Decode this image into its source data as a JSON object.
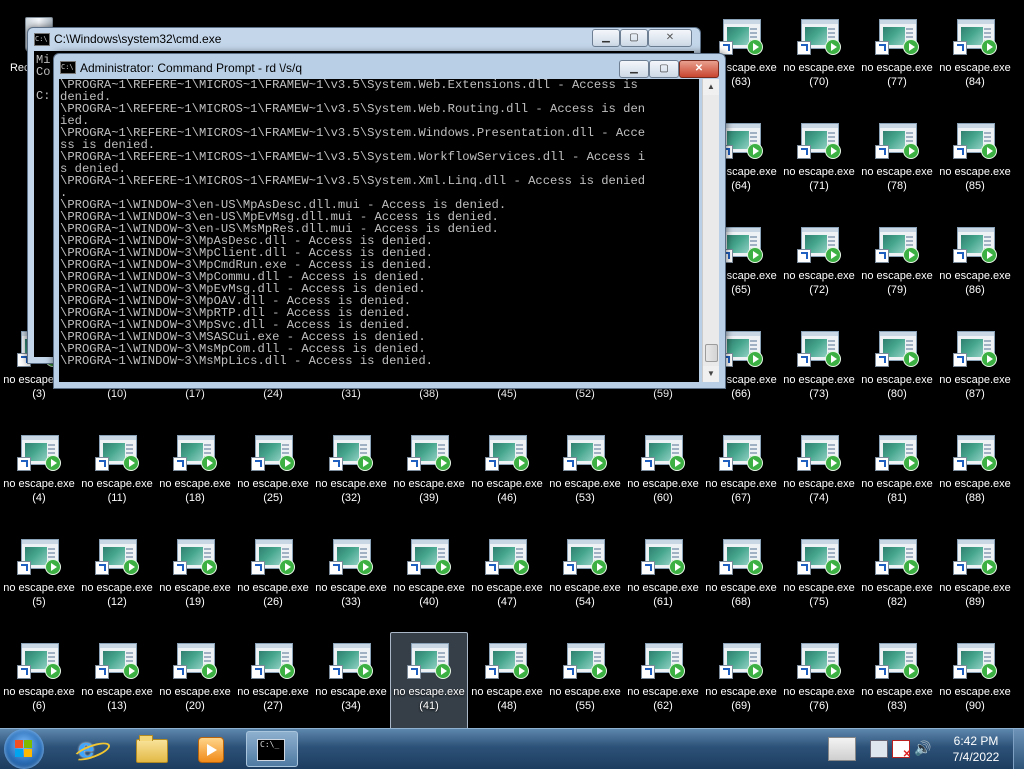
{
  "desktop": {
    "recycle_bin_label": "Recycle Bin",
    "icon_name": "no escape.exe",
    "numbers": [
      3,
      4,
      5,
      6,
      10,
      11,
      12,
      13,
      17,
      18,
      19,
      20,
      24,
      25,
      26,
      27,
      31,
      32,
      33,
      34,
      38,
      39,
      40,
      41,
      45,
      46,
      47,
      48,
      52,
      53,
      54,
      55,
      59,
      60,
      61,
      62,
      63,
      64,
      65,
      66,
      67,
      68,
      69,
      70,
      71,
      72,
      73,
      74,
      75,
      76,
      77,
      78,
      79,
      80,
      81,
      82,
      83,
      84,
      85,
      86,
      87,
      88,
      89,
      90
    ],
    "selected_number": 41
  },
  "cmd_back": {
    "title": "C:\\Windows\\system32\\cmd.exe",
    "lines": [
      "Mi",
      "Co",
      "",
      "C:"
    ]
  },
  "cmd_front": {
    "title": "Administrator: Command Prompt - rd \\/s/q",
    "lines": [
      "\\PROGRA~1\\REFERE~1\\MICROS~1\\FRAMEW~1\\v3.5\\System.Web.Extensions.dll - Access is",
      "denied.",
      "\\PROGRA~1\\REFERE~1\\MICROS~1\\FRAMEW~1\\v3.5\\System.Web.Routing.dll - Access is den",
      "ied.",
      "\\PROGRA~1\\REFERE~1\\MICROS~1\\FRAMEW~1\\v3.5\\System.Windows.Presentation.dll - Acce",
      "ss is denied.",
      "\\PROGRA~1\\REFERE~1\\MICROS~1\\FRAMEW~1\\v3.5\\System.WorkflowServices.dll - Access i",
      "s denied.",
      "\\PROGRA~1\\REFERE~1\\MICROS~1\\FRAMEW~1\\v3.5\\System.Xml.Linq.dll - Access is denied",
      ".",
      "\\PROGRA~1\\WINDOW~3\\en-US\\MpAsDesc.dll.mui - Access is denied.",
      "\\PROGRA~1\\WINDOW~3\\en-US\\MpEvMsg.dll.mui - Access is denied.",
      "\\PROGRA~1\\WINDOW~3\\en-US\\MsMpRes.dll.mui - Access is denied.",
      "\\PROGRA~1\\WINDOW~3\\MpAsDesc.dll - Access is denied.",
      "\\PROGRA~1\\WINDOW~3\\MpClient.dll - Access is denied.",
      "\\PROGRA~1\\WINDOW~3\\MpCmdRun.exe - Access is denied.",
      "\\PROGRA~1\\WINDOW~3\\MpCommu.dll - Access is denied.",
      "\\PROGRA~1\\WINDOW~3\\MpEvMsg.dll - Access is denied.",
      "\\PROGRA~1\\WINDOW~3\\MpOAV.dll - Access is denied.",
      "\\PROGRA~1\\WINDOW~3\\MpRTP.dll - Access is denied.",
      "\\PROGRA~1\\WINDOW~3\\MpSvc.dll - Access is denied.",
      "\\PROGRA~1\\WINDOW~3\\MSASCui.exe - Access is denied.",
      "\\PROGRA~1\\WINDOW~3\\MsMpCom.dll - Access is denied.",
      "\\PROGRA~1\\WINDOW~3\\MsMpLics.dll - Access is denied."
    ]
  },
  "taskbar": {
    "pinned": [
      "Internet Explorer",
      "Windows Explorer",
      "Windows Media Player",
      "Command Prompt"
    ],
    "clock_time": "6:42 PM",
    "clock_date": "7/4/2022"
  },
  "colors": {
    "console_text": "#c0c0c0",
    "console_bg": "#000000",
    "desktop_bg": "#000000"
  }
}
